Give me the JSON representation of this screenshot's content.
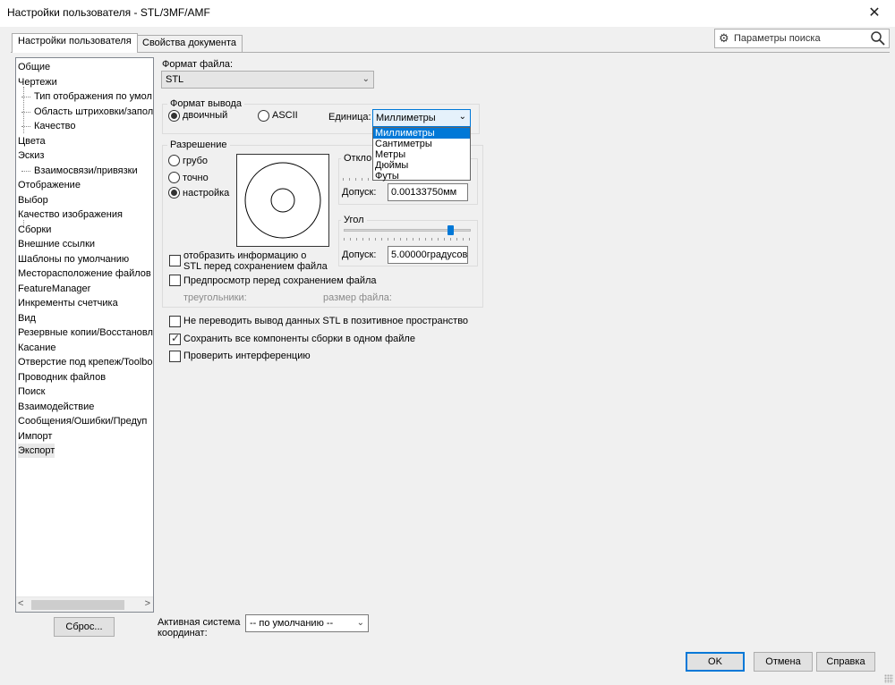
{
  "window": {
    "title": "Настройки пользователя - STL/3MF/AMF",
    "close_glyph": "✕"
  },
  "tabs": [
    {
      "label": "Настройки пользователя"
    },
    {
      "label": "Свойства документа"
    }
  ],
  "search": {
    "placeholder": "Параметры поиска"
  },
  "tree": {
    "items": [
      "Общие",
      "Чертежи",
      "Тип отображения по умол",
      "Область штриховки/запол",
      "Качество",
      "Цвета",
      "Эскиз",
      "Взаимосвязи/привязки",
      "Отображение",
      "Выбор",
      "Качество изображения",
      "Сборки",
      "Внешние ссылки",
      "Шаблоны по умолчанию",
      "Месторасположение файлов",
      "FeatureManager",
      "Инкременты счетчика",
      "Вид",
      "Резервные копии/Восстановл",
      "Касание",
      "Отверстие под крепеж/Toolbo",
      "Проводник файлов",
      "Поиск",
      "Взаимодействие",
      "Сообщения/Ошибки/Предуп",
      "Импорт",
      "Экспорт"
    ],
    "scroll_left": "<",
    "scroll_right": ">"
  },
  "reset_button": "Сброс...",
  "file_format": {
    "label": "Формат файла:",
    "value": "STL"
  },
  "output_format": {
    "title": "Формат вывода",
    "binary": "двоичный",
    "ascii": "ASCII",
    "selected": "двоичный",
    "unit_label": "Единица:",
    "unit_value": "Миллиметры",
    "unit_options": [
      "Миллиметры",
      "Сантиметры",
      "Метры",
      "Дюймы",
      "Футы"
    ]
  },
  "resolution": {
    "title": "Разрешение",
    "coarse": "грубо",
    "fine": "точно",
    "custom": "настройка",
    "selected": "настройка",
    "deviation_title": "Отклон",
    "deviation_tolerance_label": "Допуск:",
    "deviation_tolerance_value": "0.00133750мм",
    "angle_title": "Угол",
    "angle_tolerance_label": "Допуск:",
    "angle_tolerance_value": "5.00000градусов",
    "show_info_label_1": "отобразить информацию о",
    "show_info_label_2": "STL перед сохранением файла",
    "preview_label": "Предпросмотр перед сохранением файла",
    "triangles_label": "треугольники:",
    "file_size_label": "размер файла:"
  },
  "options": {
    "no_positive_space": {
      "label": "Не переводить вывод данных STL в позитивное пространство",
      "checked": false
    },
    "save_all_components": {
      "label": "Сохранить все компоненты сборки в одном файле",
      "checked": true
    },
    "check_interference": {
      "label": "Проверить интерференцию",
      "checked": false
    }
  },
  "coord_system": {
    "label_1": "Активная система",
    "label_2": "координат:",
    "value": "-- по умолчанию --"
  },
  "buttons": {
    "ok": "OK",
    "cancel": "Отмена",
    "help": "Справка"
  }
}
